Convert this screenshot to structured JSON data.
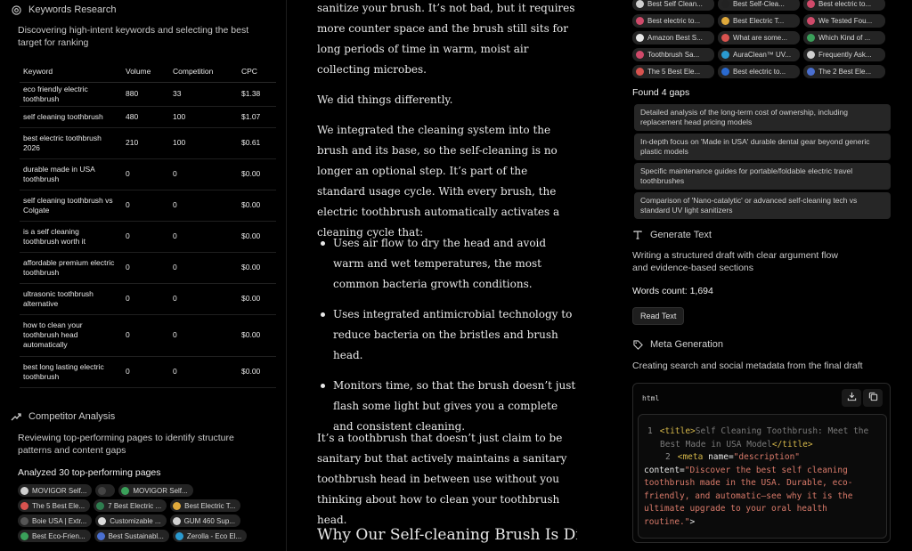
{
  "keywords_section": {
    "title": "Keywords Research",
    "description": "Discovering high-intent keywords and selecting the best target for ranking",
    "columns": [
      "Keyword",
      "Volume",
      "Competition",
      "CPC"
    ],
    "rows": [
      {
        "keyword": "eco friendly electric toothbrush",
        "volume": "880",
        "competition": "33",
        "cpc": "$1.38"
      },
      {
        "keyword": "self cleaning toothbrush",
        "volume": "480",
        "competition": "100",
        "cpc": "$1.07"
      },
      {
        "keyword": "best electric toothbrush 2026",
        "volume": "210",
        "competition": "100",
        "cpc": "$0.61"
      },
      {
        "keyword": "durable made in USA toothbrush",
        "volume": "0",
        "competition": "0",
        "cpc": "$0.00"
      },
      {
        "keyword": "self cleaning toothbrush vs Colgate",
        "volume": "0",
        "competition": "0",
        "cpc": "$0.00"
      },
      {
        "keyword": "is a self cleaning toothbrush worth it",
        "volume": "0",
        "competition": "0",
        "cpc": "$0.00"
      },
      {
        "keyword": "affordable premium electric toothbrush",
        "volume": "0",
        "competition": "0",
        "cpc": "$0.00"
      },
      {
        "keyword": "ultrasonic toothbrush alternative",
        "volume": "0",
        "competition": "0",
        "cpc": "$0.00"
      },
      {
        "keyword": "how to clean your toothbrush head automatically",
        "volume": "0",
        "competition": "0",
        "cpc": "$0.00"
      },
      {
        "keyword": "best long lasting electric toothbrush",
        "volume": "0",
        "competition": "0",
        "cpc": "$0.00"
      }
    ]
  },
  "competitor_section": {
    "title": "Competitor Analysis",
    "description": "Reviewing top-performing pages to identify structure patterns and content gaps",
    "analyzed_label": "Analyzed 30 top-performing pages",
    "chips": [
      [
        {
          "label": "MOVIGOR Self...",
          "color": "#cfcfcf"
        },
        {
          "label": "",
          "color": "#444444"
        },
        {
          "label": "MOVIGOR Self...",
          "color": "#3aa05a"
        }
      ],
      [
        {
          "label": "The 5 Best Ele...",
          "color": "#d9534f"
        },
        {
          "label": "7 Best Electric ...",
          "color": "#2e7d4f"
        },
        {
          "label": "Best Electric T...",
          "color": "#e0a93b"
        }
      ],
      [
        {
          "label": "Boie USA | Extr...",
          "color": "#555555"
        },
        {
          "label": "Customizable ...",
          "color": "#dddddd"
        },
        {
          "label": "GUM 460 Sup...",
          "color": "#d0d0d0"
        }
      ],
      [
        {
          "label": "Best Eco-Frien...",
          "color": "#3aa05a"
        },
        {
          "label": "Best Sustainabl...",
          "color": "#4a6fd0"
        },
        {
          "label": "Zerolla - Eco El...",
          "color": "#2a9ad0"
        }
      ]
    ]
  },
  "article": {
    "p1": "sanitize your brush. It’s not bad, but it requires more counter space and the brush still sits for long periods of time in warm, moist air collecting microbes.",
    "p2": "We did things differently.",
    "p3": "We integrated the cleaning system into the brush and its base, so the self-cleaning is no longer an optional step. It’s part of the standard usage cycle. With every brush, the electric toothbrush automatically activates a cleaning cycle that:",
    "bullets": [
      "Uses air flow to dry the head and avoid warm and wet temperatures, the most common bacteria growth conditions.",
      "Uses integrated antimicrobial technology to reduce bacteria on the bristles and brush head.",
      "Monitors time, so that the brush doesn’t just flash some light but gives you a complete and consistent cleaning."
    ],
    "p4": "It’s a toothbrush that doesn’t just claim to be sanitary but that actively maintains a sanitary toothbrush head in between use without you thinking about how to clean your toothbrush head.",
    "h2": "Why Our Self-cleaning Brush Is Different Than Colgate"
  },
  "sources": [
    [
      {
        "label": "Best Self Clean...",
        "color": "#cfcfcf"
      },
      {
        "label": "Best Self-Clea...",
        "color": "#222222"
      },
      {
        "label": "Best electric to...",
        "color": "#d04a6a"
      }
    ],
    [
      {
        "label": "Best electric to...",
        "color": "#d04a6a"
      },
      {
        "label": "Best Electric T...",
        "color": "#e0a93b"
      },
      {
        "label": "We Tested Fou...",
        "color": "#d04a6a"
      }
    ],
    [
      {
        "label": "Amazon Best S...",
        "color": "#e8e8e8"
      },
      {
        "label": "What are some...",
        "color": "#d9534f"
      },
      {
        "label": "Which Kind of ...",
        "color": "#3aa05a"
      }
    ],
    [
      {
        "label": "Toothbrush Sa...",
        "color": "#d04a6a"
      },
      {
        "label": "AuraClean™ UV...",
        "color": "#2a9ad0"
      },
      {
        "label": "Frequently Ask...",
        "color": "#cfcfcf"
      }
    ],
    [
      {
        "label": "The 5 Best Ele...",
        "color": "#d9534f"
      },
      {
        "label": "Best electric to...",
        "color": "#2a6ad0"
      },
      {
        "label": "The 2 Best Ele...",
        "color": "#4a6fd0"
      }
    ]
  ],
  "gaps": {
    "title": "Found 4 gaps",
    "items": [
      "Detailed analysis of the long-term cost of ownership, including replacement head pricing models",
      "In-depth focus on 'Made in USA' durable dental gear beyond generic plastic models",
      "Specific maintenance guides for portable/foldable electric travel toothbrushes",
      "Comparison of 'Nano-catalytic' or advanced self-cleaning tech vs standard UV light sanitizers"
    ]
  },
  "generate_text": {
    "title": "Generate Text",
    "description": "Writing a structured draft with clear argument flow and evidence-based sections",
    "words": "Words count: 1,694",
    "read_label": "Read Text"
  },
  "meta": {
    "title": "Meta Generation",
    "description": "Creating search and social metadata from the final draft",
    "lang": "html",
    "line1_num": "1",
    "line1_open": "<title>",
    "line1_text": "Self Cleaning Toothbrush: Meet the Best Made in USA Model",
    "line1_close": "</title>",
    "line2_num": "2",
    "line2_tag": "<meta",
    "line2_attr": " name=",
    "line2_name": "\"description\"",
    "line2_content_attr": "content=",
    "line2_content": "\"Discover the best self cleaning toothbrush made in the USA. Durable, eco-friendly, and automatic—see why it is the ultimate upgrade to your oral health routine.\"",
    "line2_end": ">"
  },
  "colors": {
    "background": "#000000",
    "chip": "#242424",
    "gap_card": "#262626",
    "tag": "#d6b84a",
    "string": "#d97a6a"
  }
}
